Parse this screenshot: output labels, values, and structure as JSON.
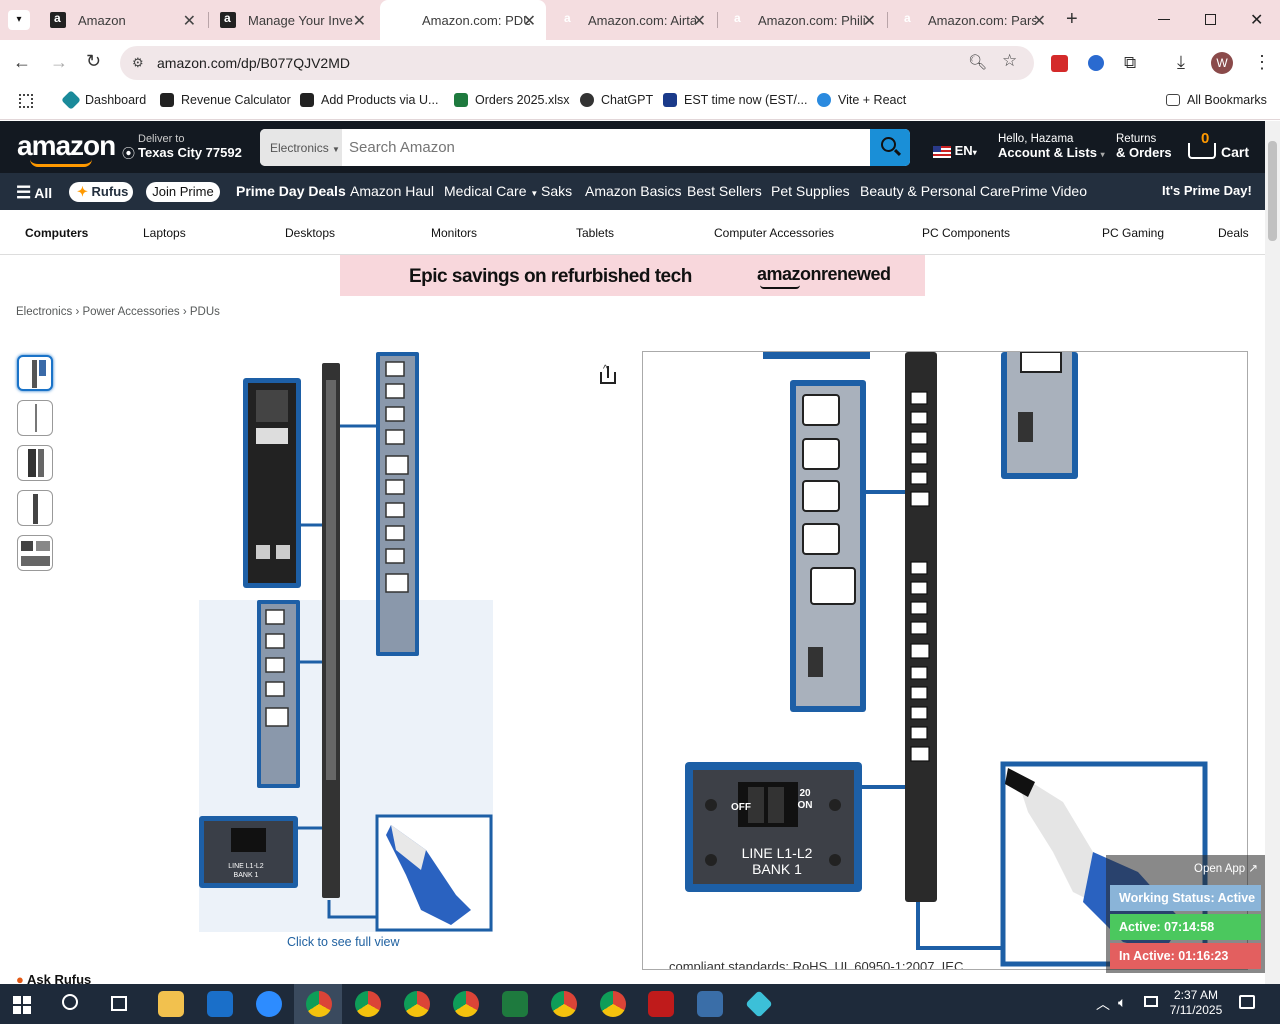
{
  "browser": {
    "tabs": [
      {
        "title": "Amazon",
        "active": false
      },
      {
        "title": "Manage Your Inve",
        "active": false
      },
      {
        "title": "Amazon.com: PDU",
        "active": true
      },
      {
        "title": "Amazon.com: Airta",
        "active": false
      },
      {
        "title": "Amazon.com: Phili",
        "active": false
      },
      {
        "title": "Amazon.com: Pars",
        "active": false
      }
    ],
    "url": "amazon.com/dp/B077QJV2MD",
    "profile_initial": "W",
    "bookmarks": [
      {
        "label": "Dashboard",
        "color": "#1a8a9a"
      },
      {
        "label": "Revenue Calculator",
        "color": "#222"
      },
      {
        "label": "Add Products via U...",
        "color": "#222"
      },
      {
        "label": "Orders 2025.xlsx",
        "color": "#1e7a3e"
      },
      {
        "label": "ChatGPT",
        "color": "#333"
      },
      {
        "label": "EST time now (EST/...",
        "color": "#1a3a8a"
      },
      {
        "label": "Vite + React",
        "color": "#2a8adf"
      }
    ],
    "all_bookmarks": "All Bookmarks"
  },
  "amazon": {
    "logo": "amazon",
    "deliver_to_label": "Deliver to",
    "deliver_to_location": "Texas City 77592",
    "search_category": "Electronics",
    "search_placeholder": "Search Amazon",
    "language": "EN",
    "hello": "Hello, Hazama",
    "account": "Account & Lists",
    "returns": "Returns",
    "orders": "& Orders",
    "cart_count": "0",
    "cart_label": "Cart",
    "nav": {
      "all": "All",
      "rufus": "Rufus",
      "join_prime": "Join Prime",
      "items": [
        "Prime Day Deals",
        "Amazon Haul",
        "Medical Care",
        "Saks",
        "Amazon Basics",
        "Best Sellers",
        "Pet Supplies",
        "Beauty & Personal Care",
        "Prime Video"
      ],
      "promo": "It's Prime Day!"
    },
    "subnav": [
      "Computers",
      "Laptops",
      "Desktops",
      "Monitors",
      "Tablets",
      "Computer Accessories",
      "PC Components",
      "PC Gaming",
      "Deals"
    ],
    "banner": {
      "text": "Epic savings on refurbished tech",
      "brand": "amazonrenewed"
    },
    "breadcrumb": [
      "Electronics",
      "Power Accessories",
      "PDUs"
    ],
    "image_caption": "Click to see full view",
    "ask_rufus": "Ask Rufus",
    "product_text_partial": "compliant standards: RoHS, UL 60950-1:2007, IEC",
    "breaker_labels": {
      "off": "OFF",
      "on": "ON",
      "rating": "20",
      "line": "LINE L1-L2",
      "bank": "BANK 1"
    }
  },
  "widget": {
    "open_app": "Open App ↗",
    "working_status": "Working Status: Active",
    "active": "Active: 07:14:58",
    "inactive": "In Active: 01:16:23"
  },
  "taskbar": {
    "time": "2:37 AM",
    "date": "7/11/2025"
  }
}
